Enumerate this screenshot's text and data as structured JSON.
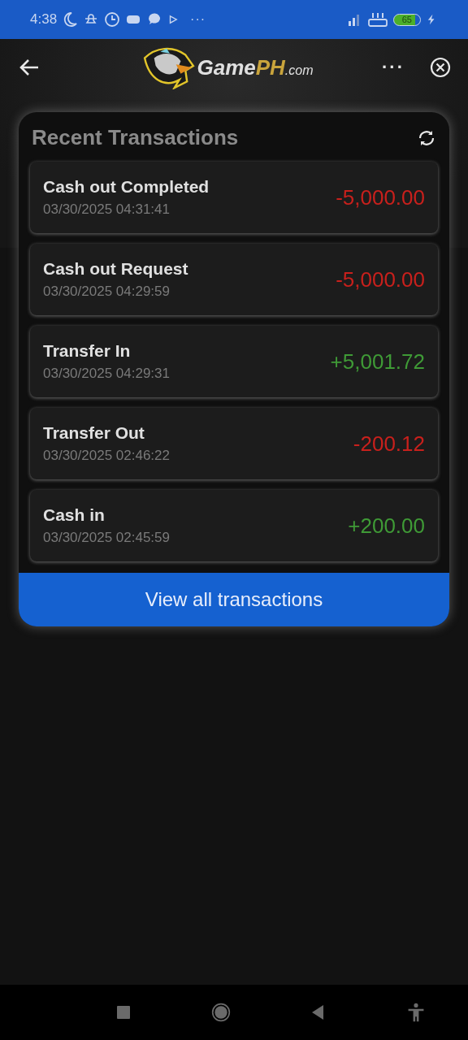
{
  "status_bar": {
    "time": "4:38",
    "more": "···",
    "battery": "65"
  },
  "header": {
    "logo_parts": [
      {
        "text": "Game",
        "kind": "plain"
      },
      {
        "text": "PH",
        "kind": "accent"
      },
      {
        "text": ".com",
        "kind": "small"
      }
    ],
    "more": "···"
  },
  "card": {
    "title": "Recent Transactions",
    "transactions": [
      {
        "title": "Cash out Completed",
        "time": "03/30/2025 04:31:41",
        "amount": "-5,000.00",
        "kind": "debit"
      },
      {
        "title": "Cash out Request",
        "time": "03/30/2025 04:29:59",
        "amount": "-5,000.00",
        "kind": "debit"
      },
      {
        "title": "Transfer In",
        "time": "03/30/2025 04:29:31",
        "amount": "+5,001.72",
        "kind": "credit"
      },
      {
        "title": "Transfer Out",
        "time": "03/30/2025 02:46:22",
        "amount": "-200.12",
        "kind": "debit"
      },
      {
        "title": "Cash in",
        "time": "03/30/2025 02:45:59",
        "amount": "+200.00",
        "kind": "credit"
      }
    ],
    "button": "View all transactions"
  }
}
